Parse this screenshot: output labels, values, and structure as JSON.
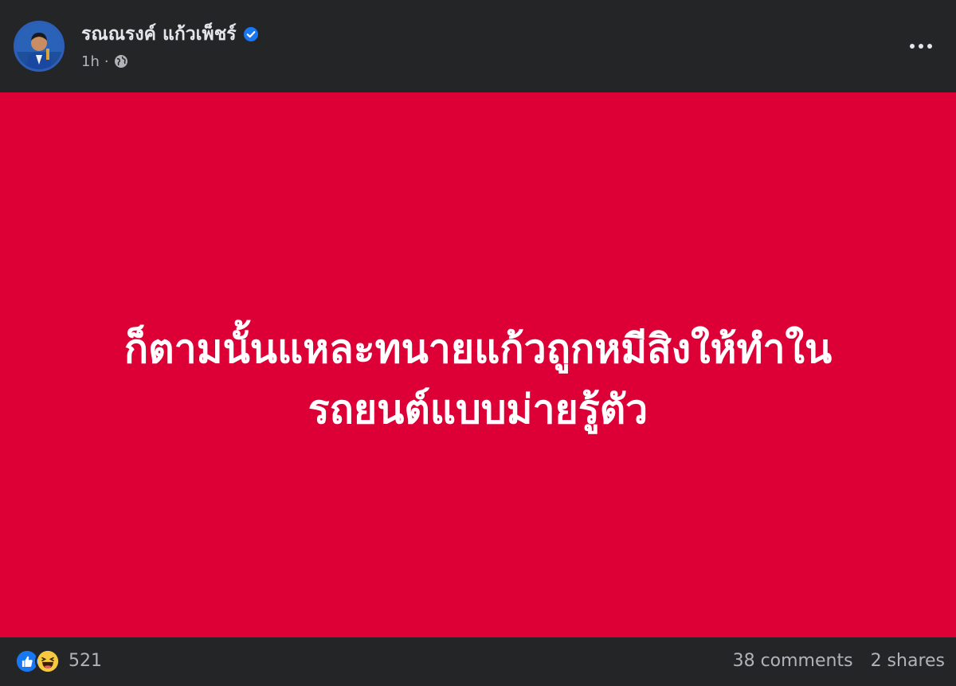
{
  "post": {
    "author": "รณณรงค์ แก้วเพ็ชร์",
    "timestamp": "1h",
    "separator": "·",
    "audience_icon": "globe-icon",
    "verified_icon": "verified-badge-icon",
    "more_icon": "more-options-icon",
    "content_lines": [
      "ก็ตามนั้นแหละทนายแก้วถูกหมีสิงให้ทำใน",
      "รถยนต์แบบม่ายรู้ตัว"
    ],
    "background_color": "#dc0037",
    "text_color": "#ffffff"
  },
  "footer": {
    "reaction_icons": [
      "like-icon",
      "haha-icon"
    ],
    "reaction_count": "521",
    "comments": "38 comments",
    "shares": "2 shares"
  },
  "colors": {
    "surface": "#242526",
    "primary_text": "#e4e6eb",
    "secondary_text": "#b0b3b8",
    "accent": "#1877f2"
  }
}
